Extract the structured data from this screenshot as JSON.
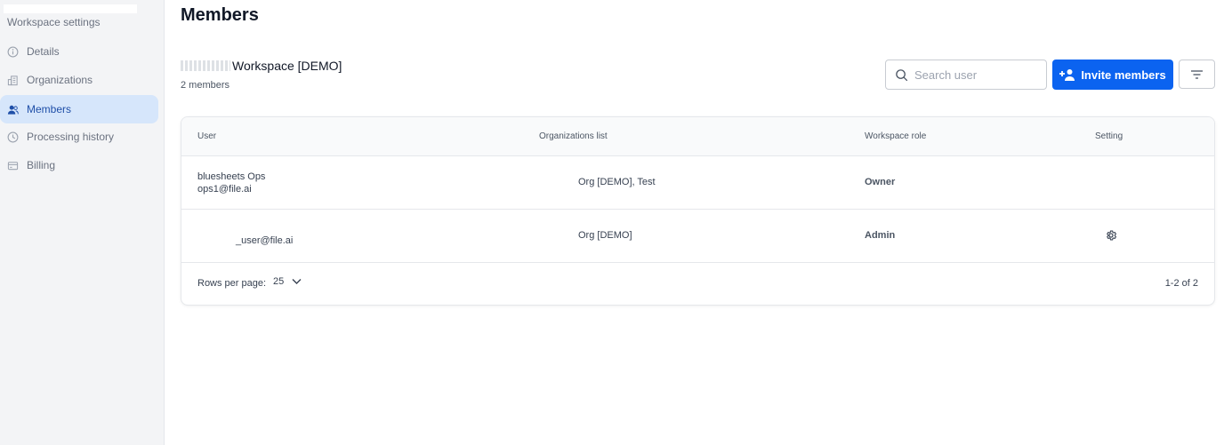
{
  "sidebar": {
    "title": "Workspace settings",
    "items": [
      {
        "label": "Details",
        "icon": "info-icon",
        "active": false
      },
      {
        "label": "Organizations",
        "icon": "building-icon",
        "active": false
      },
      {
        "label": "Members",
        "icon": "users-icon",
        "active": true
      },
      {
        "label": "Processing history",
        "icon": "history-icon",
        "active": false
      },
      {
        "label": "Billing",
        "icon": "card-icon",
        "active": false
      }
    ]
  },
  "main": {
    "title": "Members",
    "workspace_name": "Workspace [DEMO]",
    "member_count": "2 members",
    "search_placeholder": "Search user",
    "invite_label": "Invite members"
  },
  "colors": {
    "accent": "#0b63f0",
    "active_nav_bg": "#d6e6fb",
    "sidebar_bg": "#f3f4f6"
  },
  "table": {
    "headers": [
      "User",
      "Organizations list",
      "Workspace role",
      "Setting"
    ],
    "rows": [
      {
        "user_name": "bluesheets Ops",
        "user_email": "ops1@file.ai",
        "orgs": "Org [DEMO], Test",
        "role": "Owner"
      },
      {
        "user_name": "",
        "user_email": "_user@file.ai",
        "orgs": "Org [DEMO]",
        "role": "Admin"
      }
    ],
    "rows_per_page_label": "Rows per page:",
    "rows_per_page_value": "25",
    "pagination": "1-2 of  2"
  }
}
